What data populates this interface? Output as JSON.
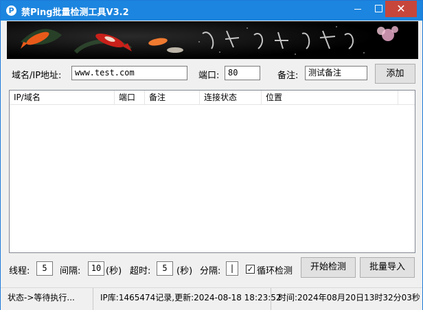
{
  "window": {
    "title": "禁Ping批量检测工具V3.2"
  },
  "titlebar": {
    "icon_letter": "P",
    "close_glyph": "✕"
  },
  "banner": {
    "calligraphy": "远 翠 泼 色 花 开 名 了 春 风 花 秀"
  },
  "form": {
    "domain_label": "域名/IP地址:",
    "domain_value": "www.test.com",
    "port_label": "端口:",
    "port_value": "80",
    "note_label": "备注:",
    "note_value": "测试备注",
    "add_button": "添加"
  },
  "table": {
    "columns": [
      "IP/域名",
      "端口",
      "备注",
      "连接状态",
      "位置"
    ],
    "rows": []
  },
  "controls": {
    "threads_label": "线程:",
    "threads_value": "5",
    "interval_label": "间隔:",
    "interval_value": "10",
    "interval_unit": "(秒)",
    "timeout_label": "超时:",
    "timeout_value": "5",
    "timeout_unit": "(秒)",
    "separator_label": "分隔:",
    "separator_value": "|",
    "loop_label": "循环检测",
    "loop_checked": true,
    "start_button": "开始检测",
    "import_button": "批量导入"
  },
  "status": {
    "state": "状态->等待执行...",
    "ipdb": "IP库:1465474记录,更新:2024-08-18 18:23:52",
    "time": "时间:2024年08月20日13时32分03秒"
  },
  "colors": {
    "titlebar": "#1c85df",
    "close": "#c7463b",
    "koi_orange": "#e85a1a",
    "koi_red": "#c8201a"
  }
}
